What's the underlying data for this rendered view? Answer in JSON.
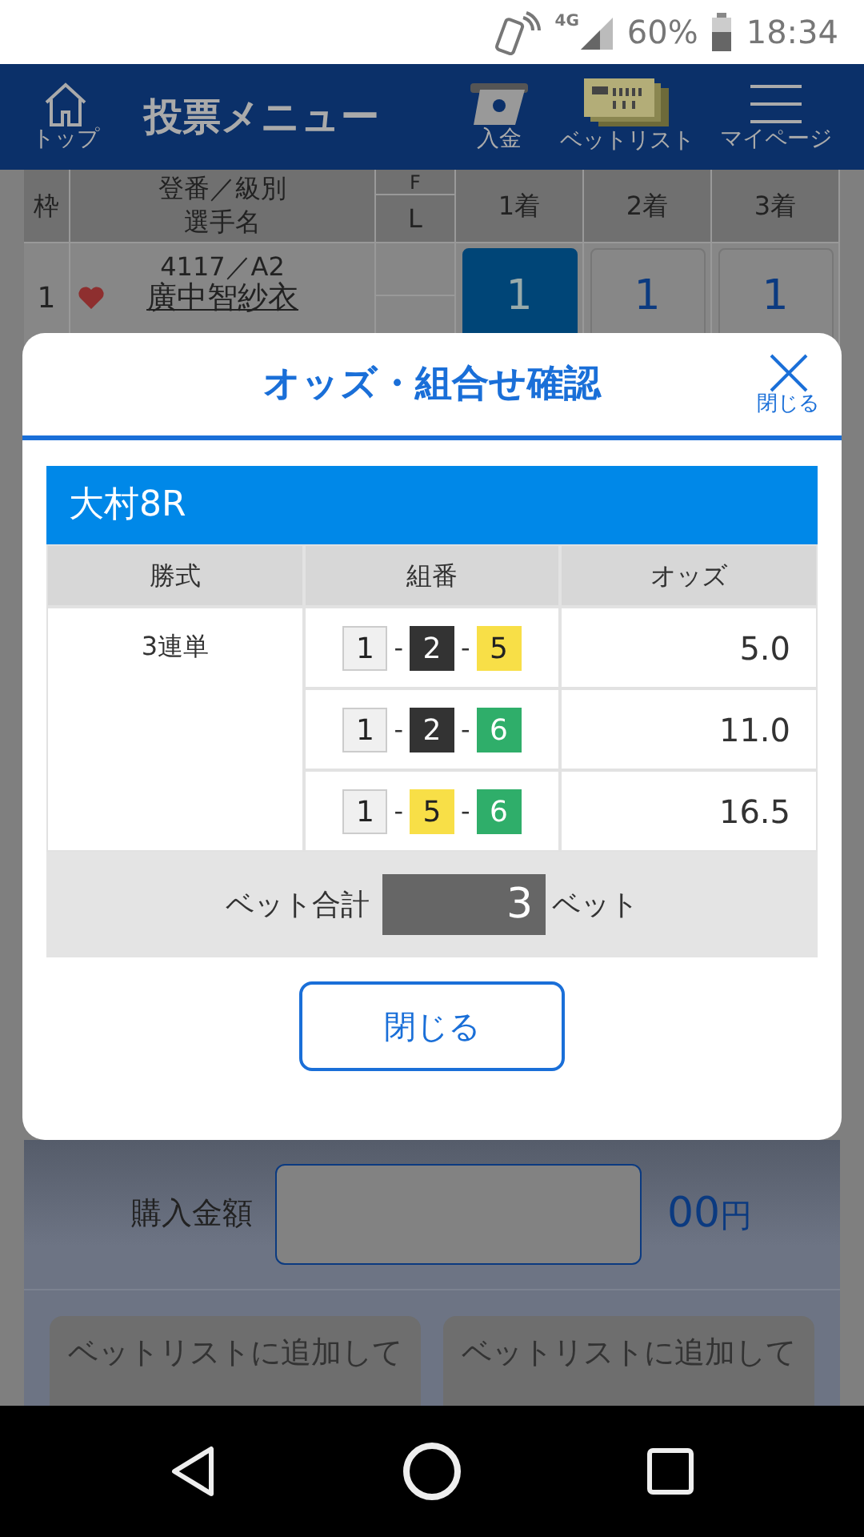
{
  "status_bar": {
    "network": "4G",
    "battery": "60%",
    "time": "18:34"
  },
  "header": {
    "home_label": "トップ",
    "title": "投票メニュー",
    "actions": [
      {
        "kind": "deposit",
        "label": "入金"
      },
      {
        "kind": "betlist",
        "label": "ベットリスト"
      },
      {
        "kind": "menu",
        "label": "マイページ"
      }
    ]
  },
  "entry_table": {
    "columns": {
      "frame": "枠",
      "registration": "登番／級別",
      "name": "選手名",
      "f": "F",
      "l": "L",
      "places": [
        "1着",
        "2着",
        "3着"
      ]
    },
    "rows": [
      {
        "frame": "1",
        "favorite": true,
        "registration": "4117／A2",
        "name": "廣中智紗衣",
        "picks": [
          {
            "label": "1",
            "selected": true
          },
          {
            "label": "1",
            "selected": false
          },
          {
            "label": "1",
            "selected": false
          }
        ]
      }
    ]
  },
  "modal": {
    "title": "オッズ・組合せ確認",
    "close_label": "閉じる",
    "race": "大村8R",
    "columns": [
      "勝式",
      "組番",
      "オッズ"
    ],
    "bet_type": "3連単",
    "combos": [
      {
        "numbers": [
          {
            "label": "1",
            "color": "#f0f0f0"
          },
          {
            "label": "2",
            "color": "#333333"
          },
          {
            "label": "5",
            "color": "#f8df47"
          }
        ],
        "odds": "5.0"
      },
      {
        "numbers": [
          {
            "label": "1",
            "color": "#f0f0f0"
          },
          {
            "label": "2",
            "color": "#333333"
          },
          {
            "label": "6",
            "color": "#2fae6a"
          }
        ],
        "odds": "11.0"
      },
      {
        "numbers": [
          {
            "label": "1",
            "color": "#f0f0f0"
          },
          {
            "label": "5",
            "color": "#f8df47"
          },
          {
            "label": "6",
            "color": "#2fae6a"
          }
        ],
        "odds": "16.5"
      }
    ],
    "separator": "-",
    "total_label": "ベット合計",
    "total": "3",
    "total_unit": "ベット",
    "button": "閉じる"
  },
  "purchase": {
    "label": "購入金額",
    "amount": "00",
    "unit": "円",
    "buttons": [
      {
        "text": "ベットリストに追加して",
        "disabled": true
      },
      {
        "text": "ベットリストに追加して",
        "disabled": true
      }
    ]
  }
}
